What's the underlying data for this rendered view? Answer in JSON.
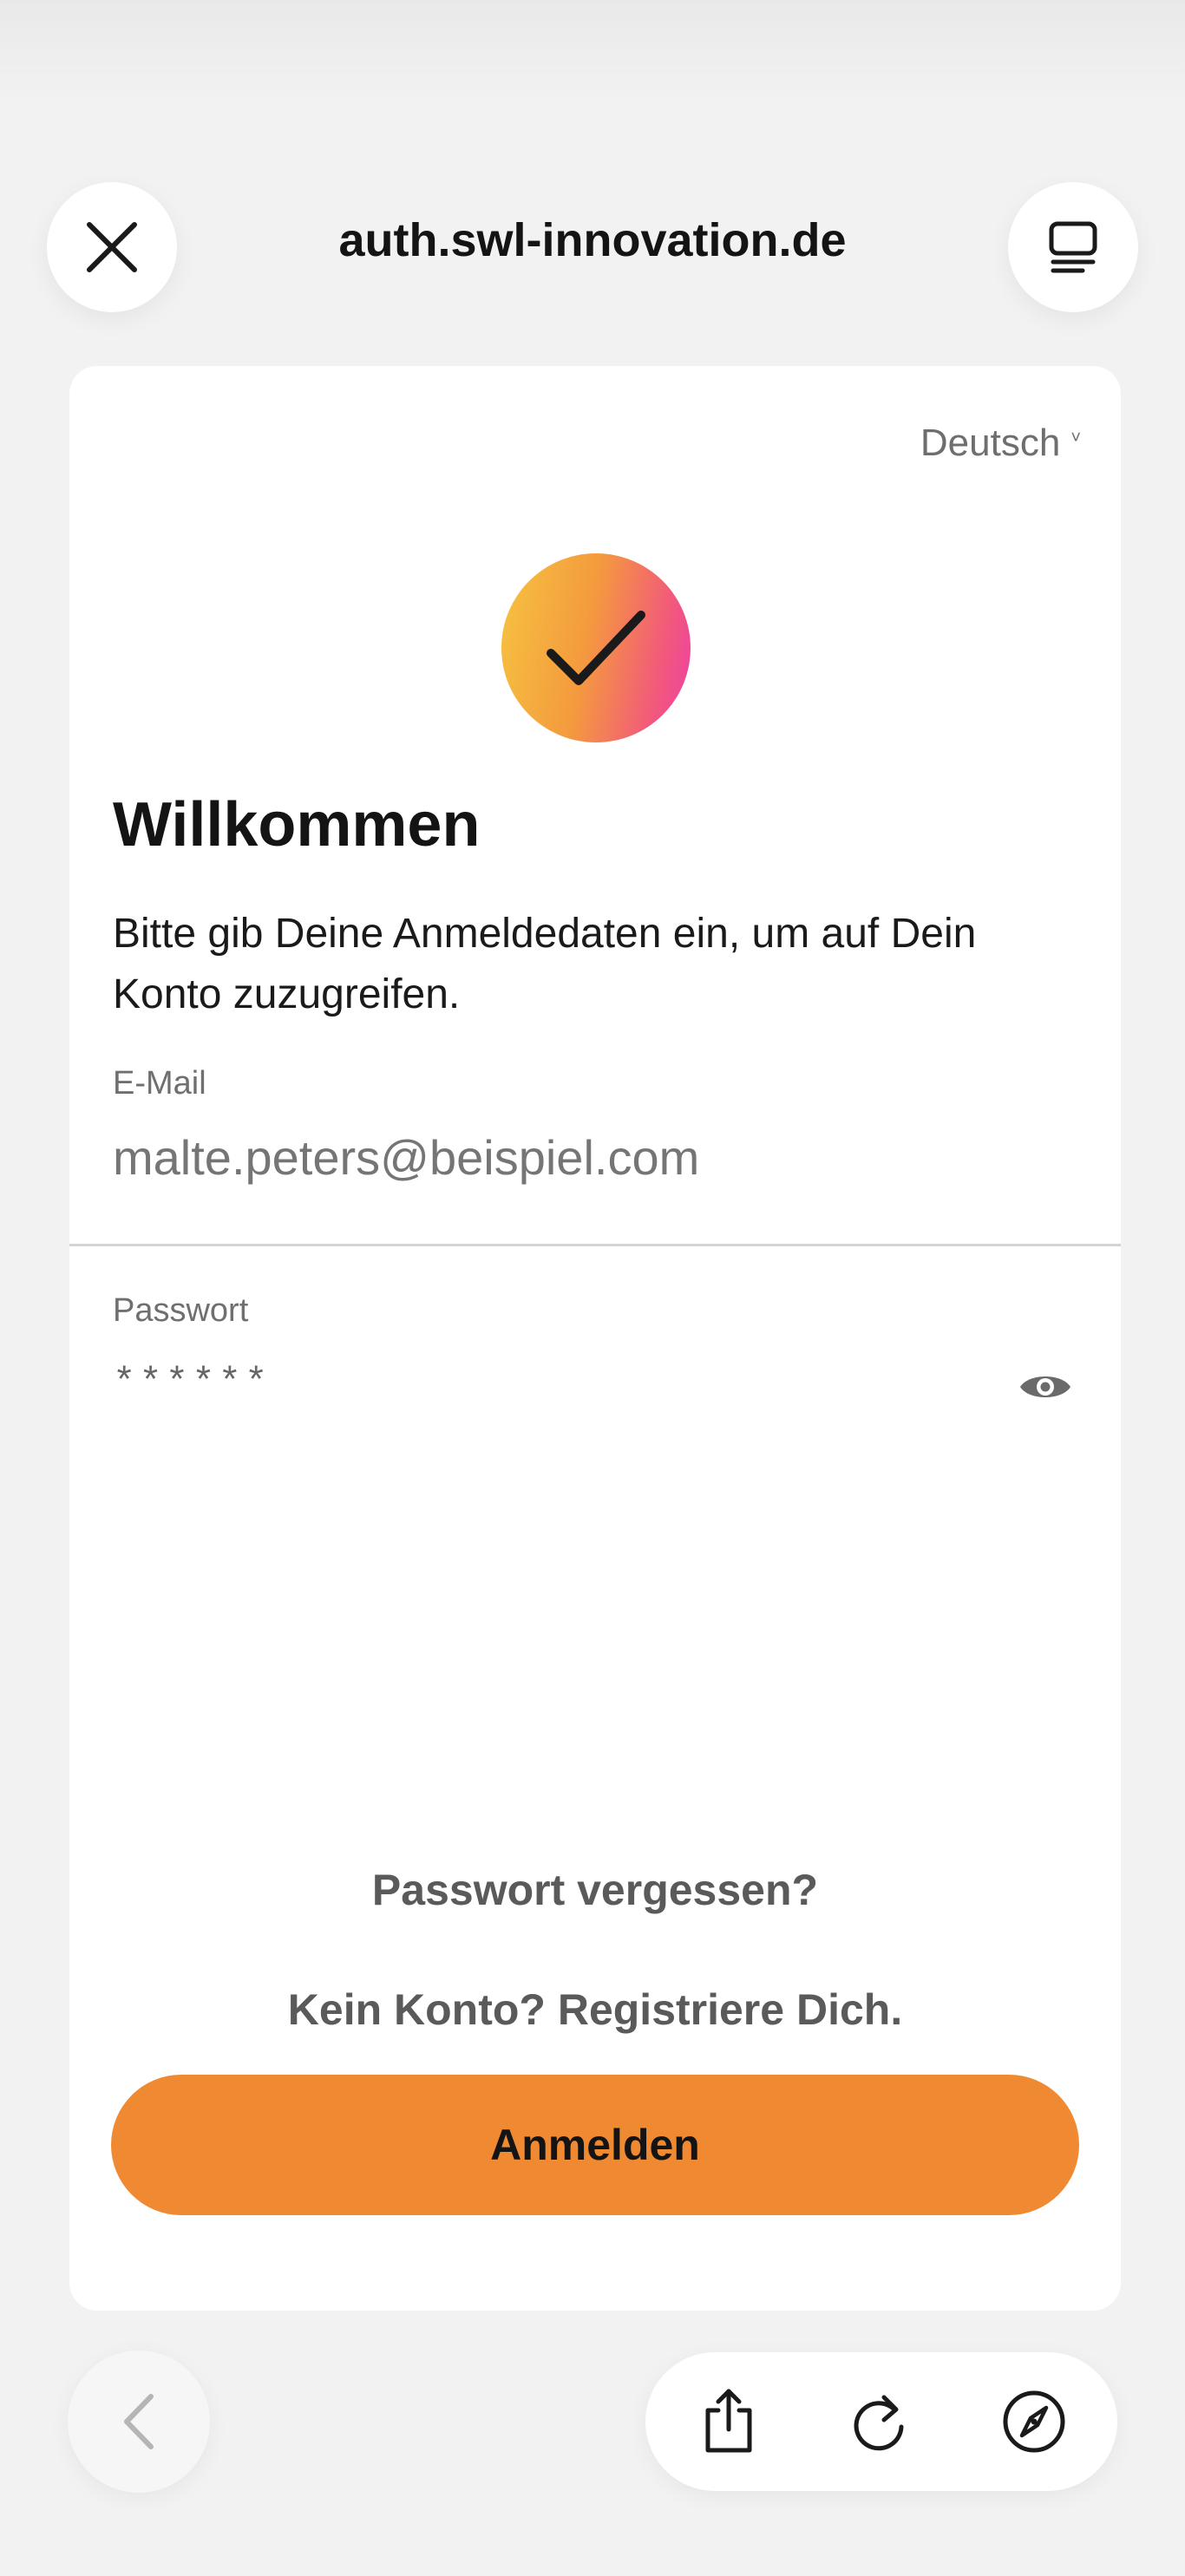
{
  "browser": {
    "url": "auth.swl-innovation.de",
    "close_icon": "close-icon",
    "reader_icon": "reader-mode-icon"
  },
  "login": {
    "language": "Deutsch",
    "language_chevron": "˅",
    "title": "Willkommen",
    "subtitle": "Bitte gib Deine Anmeldedaten ein, um auf Dein Konto zuzugreifen.",
    "email_label": "E-Mail",
    "email_placeholder": "malte.peters@beispiel.com",
    "password_label": "Passwort",
    "password_value": "******",
    "forgot_password": "Passwort vergessen?",
    "register": "Kein Konto? Registriere Dich.",
    "submit": "Anmelden"
  },
  "toolbar": {
    "icons": [
      "back-icon",
      "share-icon",
      "reload-icon",
      "compass-icon"
    ]
  },
  "colors": {
    "accent": "#ef8a33",
    "logo_gradient": [
      "#f6c340",
      "#ee3fa6"
    ]
  }
}
